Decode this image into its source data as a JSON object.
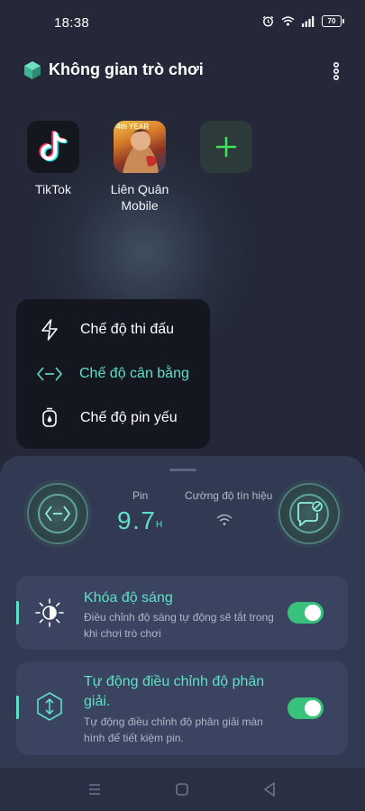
{
  "status_bar": {
    "time": "18:38",
    "battery": "70",
    "icons": [
      "alarm-icon",
      "wifi-icon",
      "signal-icon",
      "battery-icon"
    ]
  },
  "header": {
    "title": "Không gian trò chơi",
    "logo": "game-space-logo",
    "menu_icon": "more-vertical-icon"
  },
  "apps": [
    {
      "label": "TikTok",
      "icon": "tiktok-icon"
    },
    {
      "label": "Liên Quân\nMobile",
      "icon": "lien-quan-icon",
      "badge": "4th YEAR"
    },
    {
      "label": "",
      "icon": "plus-icon"
    }
  ],
  "mode_menu": {
    "items": [
      {
        "label": "Chế độ thi đấu",
        "icon": "lightning-icon",
        "active": false
      },
      {
        "label": "Chế độ cân bằng",
        "icon": "balance-icon",
        "active": true
      },
      {
        "label": "Chế độ pin yếu",
        "icon": "battery-saver-icon",
        "active": false
      }
    ]
  },
  "panel": {
    "pin_label": "Pin",
    "pin_value": "9.7",
    "pin_unit": "H",
    "signal_label": "Cường độ tín hiệu",
    "left_button_icon": "balance-icon",
    "right_button_icon": "message-block-icon"
  },
  "cards": [
    {
      "title": "Khóa độ sáng",
      "desc": "Điều chỉnh độ sáng tự động sẽ tắt trong khi chơi trò chơi",
      "icon": "brightness-icon",
      "enabled": true
    },
    {
      "title": "Tự động điều chỉnh độ phân giải.",
      "desc": "Tự động điều chỉnh độ phân giải màn hình để tiết kiệm pin.",
      "icon": "resolution-icon",
      "enabled": true
    }
  ],
  "colors": {
    "accent": "#5fe0c4",
    "toggle_on": "#38c27c",
    "background": "#242838",
    "panel": "#313a52",
    "card": "#3a4460"
  },
  "nav": {
    "items": [
      "menu-icon",
      "home-icon",
      "back-icon"
    ]
  }
}
